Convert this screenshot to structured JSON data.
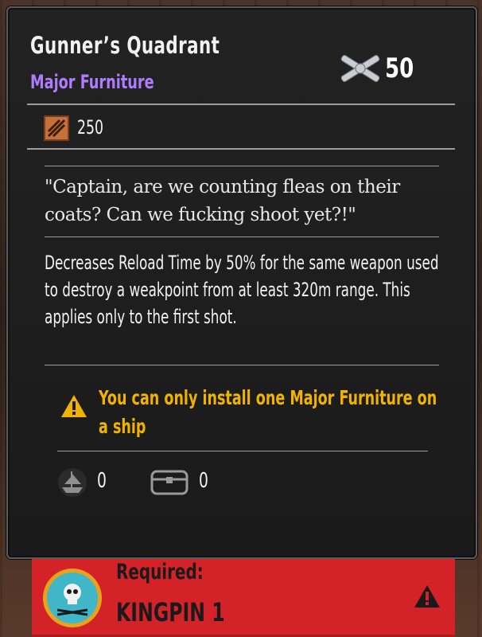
{
  "item": {
    "title": "Gunner’s Quadrant",
    "category": "Major Furniture",
    "cost_icon": "cannons-crossed-icon",
    "cost": "50"
  },
  "materials": {
    "icon": "materials-icon",
    "value": "250"
  },
  "quote": "\"Captain, are we counting fleas on their coats? Can we fucking shoot yet?!\"",
  "description": "Decreases Reload Time by 50% for the same weapon used to destroy a weakpoint from at least 320m range. This applies only to the first shot.",
  "warning": {
    "icon": "warning-triangle-icon",
    "text": "You can only install one Major Furniture on a ship"
  },
  "stats": {
    "ship_icon": "ship-icon",
    "ship_count": "0",
    "chest_icon": "chest-icon",
    "chest_count": "0"
  },
  "requirement": {
    "emblem_icon": "kingpin-skull-emblem-icon",
    "label": "Required:",
    "value": "KINGPIN 1",
    "alert_icon": "warning-triangle-icon"
  },
  "colors": {
    "category": "#b07cff",
    "warning": "#f0b400",
    "banner": "#d32328"
  }
}
